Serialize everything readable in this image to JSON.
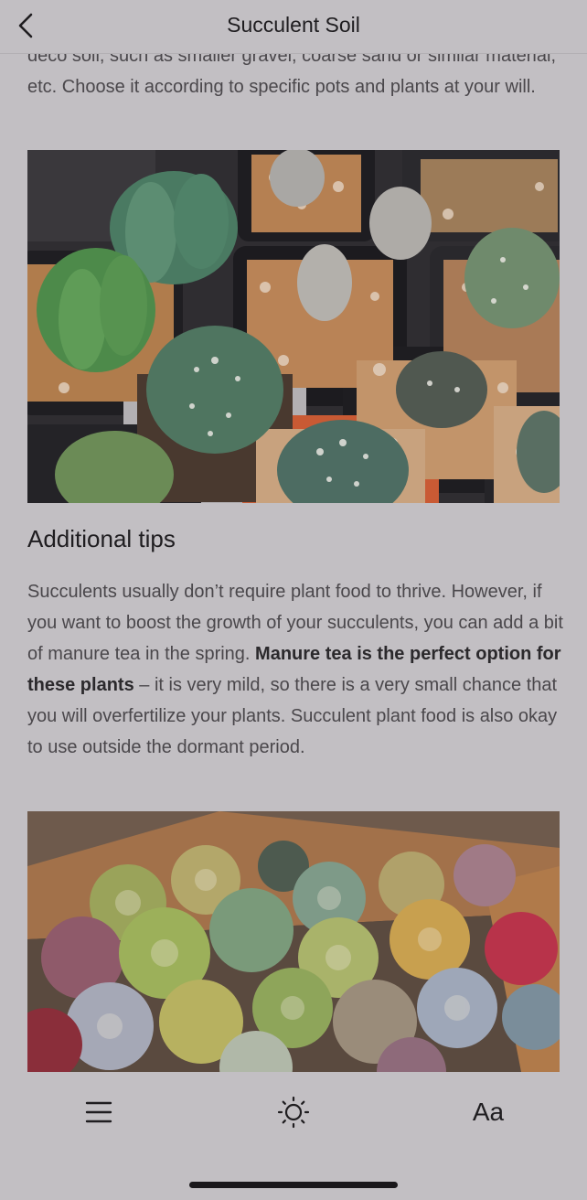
{
  "header": {
    "title": "Succulent Soil",
    "back_icon": "chevron-left-icon"
  },
  "article": {
    "intro_partial": "deco soil, such as smaller gravel, coarse sand or similar material, etc. Choose it according to specific pots and plants at your will.",
    "image1_alt": "Potted cacti in small square pots with gravel top dressing",
    "section_heading": "Additional tips",
    "tips_part1": "Succulents usually don’t require plant food to thrive. However, if you want to boost the growth of your succulents, you can add a bit of manure tea in the spring. ",
    "tips_bold": "Manure tea is the perfect option for these plants",
    "tips_part2": " – it is very mild, so there is a very small chance that you will overfertilize your plants. Succulent plant food is also okay to use outside the dormant period.",
    "image2_alt": "Assorted colorful succulents in a wooden tray"
  },
  "toolbar": {
    "menu_icon": "menu-icon",
    "brightness_icon": "brightness-icon",
    "font_label": "Aa"
  },
  "colors": {
    "background": "#c2bfc3",
    "text": "#4a474b",
    "heading": "#1f1d20"
  }
}
